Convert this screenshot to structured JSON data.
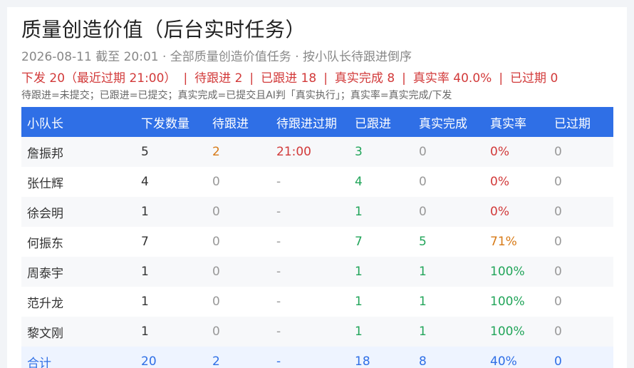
{
  "header": {
    "title": "质量创造价值（后台实时任务）",
    "subtitle": "2026-08-11 截至 20:01 · 全部质量创造价值任务 · 按小队长待跟进倒序"
  },
  "summary": {
    "items": [
      "下发 20（最近过期 21:00）",
      "待跟进 2",
      "已跟进 18",
      "真实完成 8",
      "真实率 40.0%",
      "已过期 0"
    ],
    "separator": "|"
  },
  "legend": "待跟进=未提交；已跟进=已提交；真实完成=已提交且AI判「真实执行」；真实率=真实完成/下发",
  "table": {
    "columns": [
      "小队长",
      "下发数量",
      "待跟进",
      "待跟进过期",
      "已跟进",
      "真实完成",
      "真实率",
      "已过期"
    ],
    "rows": [
      [
        "詹振邦",
        "5",
        "2",
        "21:00",
        "3",
        "0",
        "0%",
        "0"
      ],
      [
        "张仕辉",
        "4",
        "0",
        "-",
        "4",
        "0",
        "0%",
        "0"
      ],
      [
        "徐会明",
        "1",
        "0",
        "-",
        "1",
        "0",
        "0%",
        "0"
      ],
      [
        "何振东",
        "7",
        "0",
        "-",
        "7",
        "5",
        "71%",
        "0"
      ],
      [
        "周泰宇",
        "1",
        "0",
        "-",
        "1",
        "1",
        "100%",
        "0"
      ],
      [
        "范升龙",
        "1",
        "0",
        "-",
        "1",
        "1",
        "100%",
        "0"
      ],
      [
        "黎文刚",
        "1",
        "0",
        "-",
        "1",
        "1",
        "100%",
        "0"
      ]
    ],
    "total": [
      "合计",
      "20",
      "2",
      "-",
      "18",
      "8",
      "40%",
      "0"
    ]
  },
  "colors": {
    "header_bg": "#2f6fe6",
    "alert": "#d23a3a",
    "warn": "#d77a17",
    "ok": "#22a55a",
    "muted": "#999999"
  }
}
